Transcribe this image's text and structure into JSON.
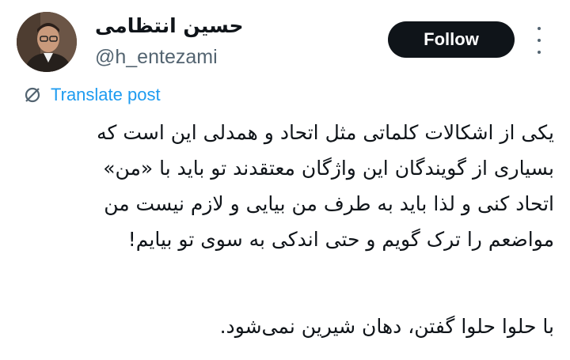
{
  "author": {
    "name": "حسین انتظامی",
    "handle": "@h_entezami"
  },
  "actions": {
    "follow_label": "Follow"
  },
  "translate": {
    "label": "Translate post"
  },
  "tweet": {
    "paragraph1": [
      "یکی از اشکالات کلماتی مثل اتحاد و همدلی این است که",
      "بسیاری از گویندگان این واژگان معتقدند تو باید با «من»",
      "اتحاد کنی و لذا باید به طرف من بیایی و لازم نیست من",
      "مواضعم را ترک گویم و حتی اندکی به سوی تو بیایم!"
    ],
    "paragraph2": "با حلوا حلوا گفتن، دهان شیرین نمی‌شود."
  },
  "colors": {
    "text": "#0f1419",
    "secondary": "#536471",
    "link": "#1d9bf0",
    "button_bg": "#0f1419",
    "button_text": "#ffffff"
  },
  "icons": {
    "more": "more-vertical-icon",
    "translate": "translate-globe-icon"
  }
}
